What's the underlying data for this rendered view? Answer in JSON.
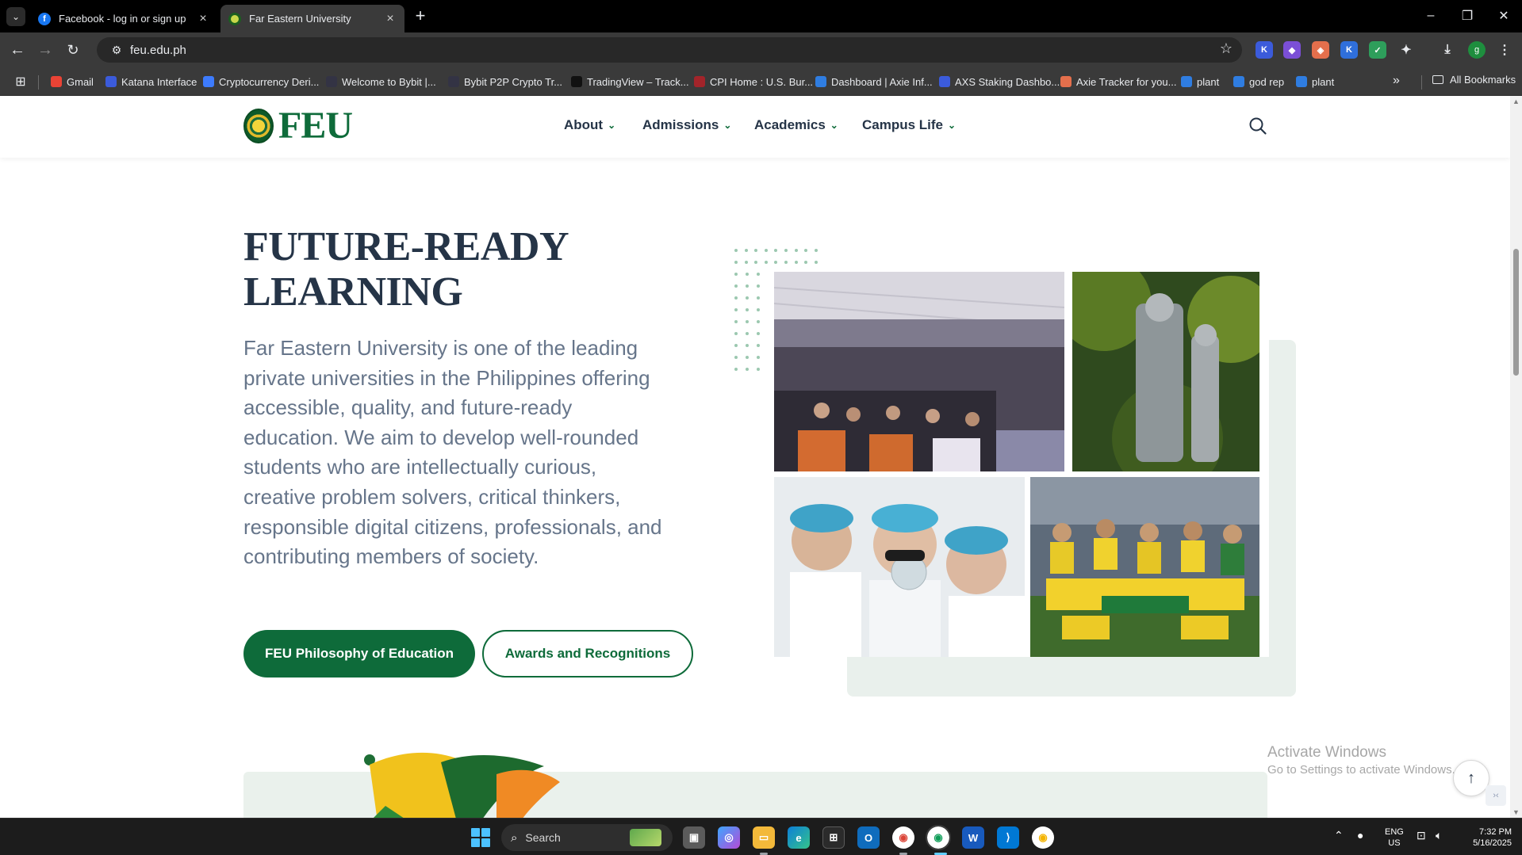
{
  "browser": {
    "tabs": [
      {
        "title": "Facebook - log in or sign up",
        "icon": "facebook-icon"
      },
      {
        "title": "Far Eastern University",
        "icon": "feu-favicon",
        "active": true
      }
    ],
    "url": "feu.edu.ph",
    "profile_initial": "g",
    "bookmarks": [
      {
        "label": "Gmail",
        "icon": "gmail-icon",
        "color": "#ea4335"
      },
      {
        "label": "Katana Interface",
        "icon": "katana-icon",
        "color": "#3b5bdb"
      },
      {
        "label": "Cryptocurrency Deri...",
        "icon": "bybit-x-icon",
        "color": "#3d7bfd"
      },
      {
        "label": "Welcome to Bybit |...",
        "icon": "bybit-icon",
        "color": "#333344"
      },
      {
        "label": "Bybit P2P Crypto Tr...",
        "icon": "bybit-icon",
        "color": "#333344"
      },
      {
        "label": "TradingView – Track...",
        "icon": "tradingview-icon",
        "color": "#111111"
      },
      {
        "label": "CPI Home : U.S. Bur...",
        "icon": "bls-icon",
        "color": "#a3242a"
      },
      {
        "label": "Dashboard | Axie Inf...",
        "icon": "axie-icon",
        "color": "#2f7de1"
      },
      {
        "label": "AXS Staking Dashbo...",
        "icon": "katana-icon",
        "color": "#3b5bdb"
      },
      {
        "label": "Axie Tracker for you...",
        "icon": "axie-tracker-icon",
        "color": "#e46f4c"
      },
      {
        "label": "plant",
        "icon": "axie-icon",
        "color": "#2f7de1"
      },
      {
        "label": "god rep",
        "icon": "axie-icon",
        "color": "#2f7de1"
      },
      {
        "label": "plant",
        "icon": "axie-icon",
        "color": "#2f7de1"
      }
    ],
    "all_bookmarks_label": "All Bookmarks"
  },
  "site": {
    "logo_text": "FEU",
    "nav": [
      {
        "label": "About"
      },
      {
        "label": "Admissions"
      },
      {
        "label": "Academics"
      },
      {
        "label": "Campus Life"
      }
    ],
    "brand_color": "#0e6b3a",
    "heading_color": "#253447"
  },
  "hero": {
    "headline_line1": "FUTURE-READY",
    "headline_line2": "LEARNING",
    "body": "Far Eastern University is one of the leading private universities in the Philippines offering accessible, quality, and future-ready education. We aim to develop well-rounded students who are intellectually curious, creative problem solvers, critical thinkers, responsible digital citizens, professionals, and contributing members of society.",
    "primary_button": "FEU Philosophy of Education",
    "secondary_button": "Awards and Recognitions",
    "photos": [
      {
        "name": "auditorium-photo"
      },
      {
        "name": "statue-photo"
      },
      {
        "name": "laboratory-photo"
      },
      {
        "name": "football-team-photo"
      }
    ]
  },
  "overlay": {
    "watermark_title": "Activate Windows",
    "watermark_sub": "Go to Settings to activate Windows."
  },
  "taskbar": {
    "search_placeholder": "Search",
    "lang_line1": "ENG",
    "lang_line2": "US",
    "time": "7:32 PM",
    "date": "5/16/2025"
  }
}
